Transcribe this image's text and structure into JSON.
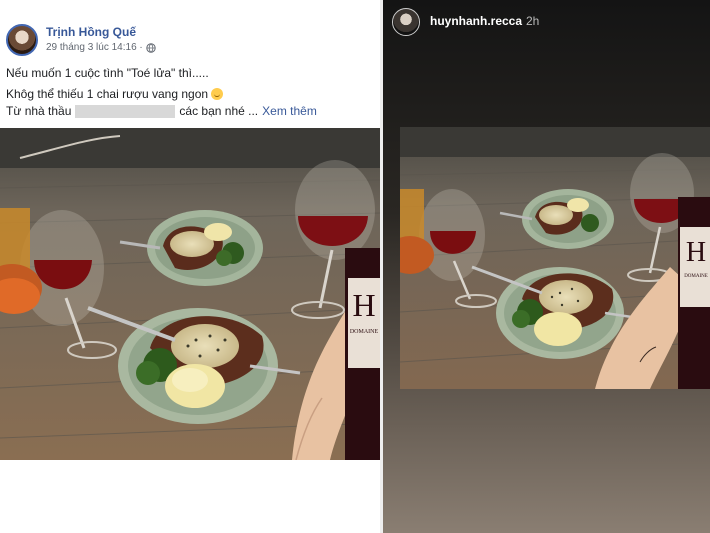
{
  "facebook_post": {
    "author": "Trịnh Hồng Quế",
    "timestamp": "29 tháng 3 lúc 14:16 ·",
    "privacy_icon": "globe-icon",
    "lines": [
      "Nếu muốn 1 cuộc tình \"Toé lửa\" thì.....",
      "Khôg thể thiếu 1 chai rượu vang ngon"
    ],
    "line3_prefix": "Từ nhà thầu",
    "line3_suffix": "các bạn nhé ...",
    "see_more": "Xem thêm",
    "emoji_icon": "smiling-face-icon",
    "name_color": "#385898"
  },
  "instagram_story": {
    "username": "huynhanh.recca",
    "time_ago": "2h"
  },
  "photo": {
    "wine_label_letter": "H",
    "wine_label_text": "DOMAINE"
  }
}
